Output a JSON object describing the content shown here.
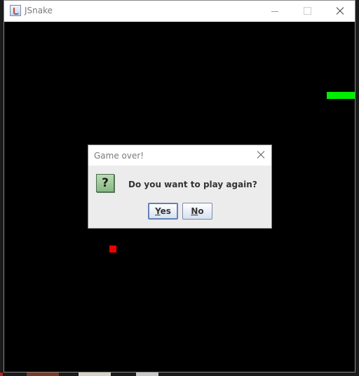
{
  "window": {
    "title": "JSnake",
    "icon": "java-app-icon",
    "controls": [
      "minimize-icon",
      "maximize-icon",
      "close-icon"
    ]
  },
  "game": {
    "background_color": "#000000",
    "snake_color": "#00ee00",
    "food_color": "#ee0000"
  },
  "dialog": {
    "title": "Game over!",
    "icon": "question-icon",
    "icon_glyph": "?",
    "message": "Do you want to play again?",
    "yes_label": "Yes",
    "yes_mnemonic": "Y",
    "yes_rest": "es",
    "no_label": "No",
    "no_mnemonic": "N",
    "no_rest": "o"
  }
}
